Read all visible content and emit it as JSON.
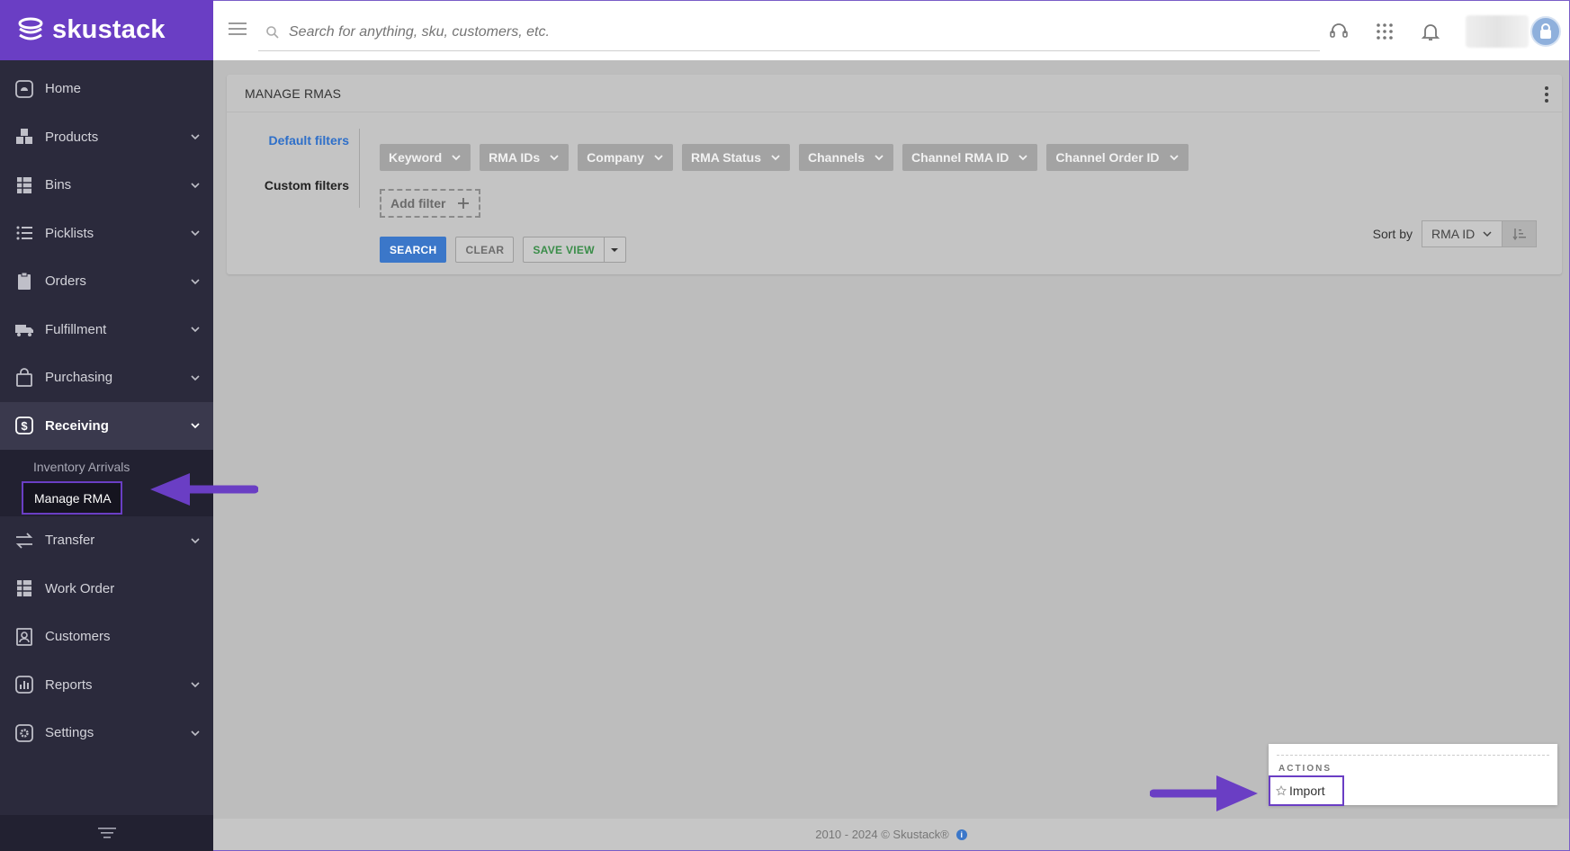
{
  "brand": {
    "name": "skustack"
  },
  "search": {
    "placeholder": "Search for anything, sku, customers, etc."
  },
  "sidebar": {
    "items": [
      {
        "label": "Home",
        "icon": "home-icon"
      },
      {
        "label": "Products",
        "icon": "products-icon"
      },
      {
        "label": "Bins",
        "icon": "bins-icon"
      },
      {
        "label": "Picklists",
        "icon": "list-icon"
      },
      {
        "label": "Orders",
        "icon": "clipboard-icon"
      },
      {
        "label": "Fulfillment",
        "icon": "truck-icon"
      },
      {
        "label": "Purchasing",
        "icon": "bag-icon"
      },
      {
        "label": "Receiving",
        "icon": "dollar-icon"
      },
      {
        "label": "Transfer",
        "icon": "transfer-icon"
      },
      {
        "label": "Work Order",
        "icon": "table-icon"
      },
      {
        "label": "Customers",
        "icon": "customers-icon"
      },
      {
        "label": "Reports",
        "icon": "chart-icon"
      },
      {
        "label": "Settings",
        "icon": "gear-icon"
      }
    ],
    "receiving_sub": [
      {
        "label": "Inventory Arrivals"
      },
      {
        "label": "Manage RMA"
      }
    ]
  },
  "card": {
    "title": "MANAGE RMAS",
    "default_filters_label": "Default filters",
    "custom_filters_label": "Custom filters",
    "chips": [
      {
        "label": "Keyword"
      },
      {
        "label": "RMA IDs"
      },
      {
        "label": "Company"
      },
      {
        "label": "RMA Status"
      },
      {
        "label": "Channels"
      },
      {
        "label": "Channel RMA ID"
      },
      {
        "label": "Channel Order ID"
      }
    ],
    "add_filter_label": "Add filter",
    "search_label": "SEARCH",
    "clear_label": "CLEAR",
    "save_view_label": "SAVE VIEW",
    "sort_by_label": "Sort by",
    "sort_value": "RMA ID"
  },
  "actions": {
    "title": "ACTIONS",
    "import_label": "Import"
  },
  "footer": {
    "text": "2010 - 2024 © Skustack®",
    "info_glyph": "i"
  },
  "colors": {
    "brand": "#6a3ec4",
    "sidebar": "#2b2a3c",
    "primary": "#3b77c9",
    "success": "#3a8d49"
  }
}
